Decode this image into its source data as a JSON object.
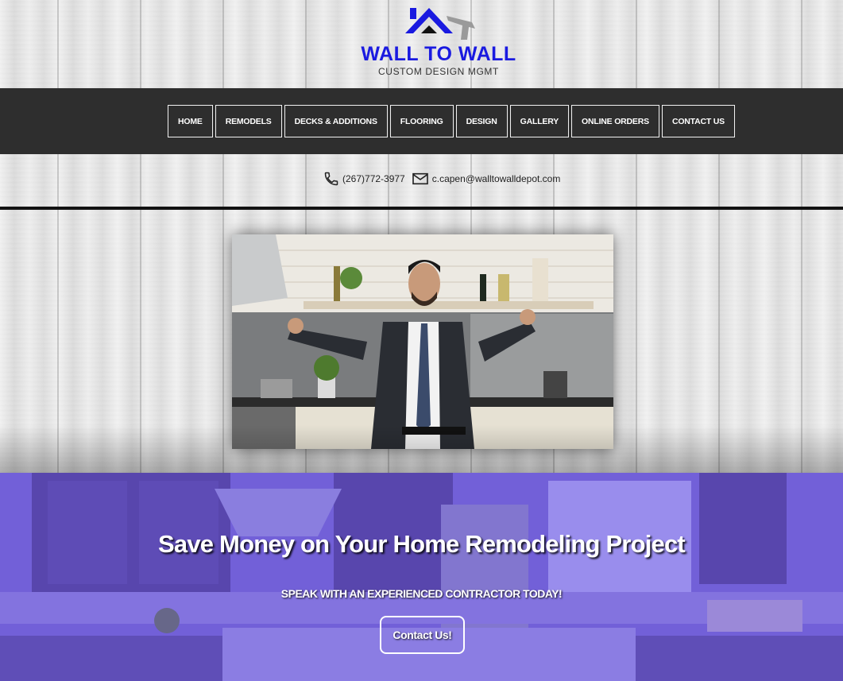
{
  "brand": {
    "name": "WALL TO WALL",
    "tagline": "CUSTOM DESIGN MGMT"
  },
  "nav": {
    "items": [
      {
        "label": "HOME"
      },
      {
        "label": "REMODELS"
      },
      {
        "label": "DECKS & ADDITIONS"
      },
      {
        "label": "FLOORING"
      },
      {
        "label": "DESIGN"
      },
      {
        "label": "GALLERY"
      },
      {
        "label": "ONLINE ORDERS"
      },
      {
        "label": "CONTACT US"
      }
    ]
  },
  "contact": {
    "phone": "(267)772-3977",
    "email": "c.capen@walltowalldepot.com",
    "phone_icon": "phone-icon",
    "email_icon": "envelope-icon"
  },
  "hero": {
    "title": "Save Money on Your Home Remodeling Project",
    "subtitle": "SPEAK WITH AN EXPERIENCED CONTRACTOR TODAY!",
    "button_label": "Contact Us!"
  },
  "colors": {
    "brand_blue": "#1a1ae0",
    "nav_bg": "#2e2e2e",
    "hero_tint": "#7864eb"
  }
}
